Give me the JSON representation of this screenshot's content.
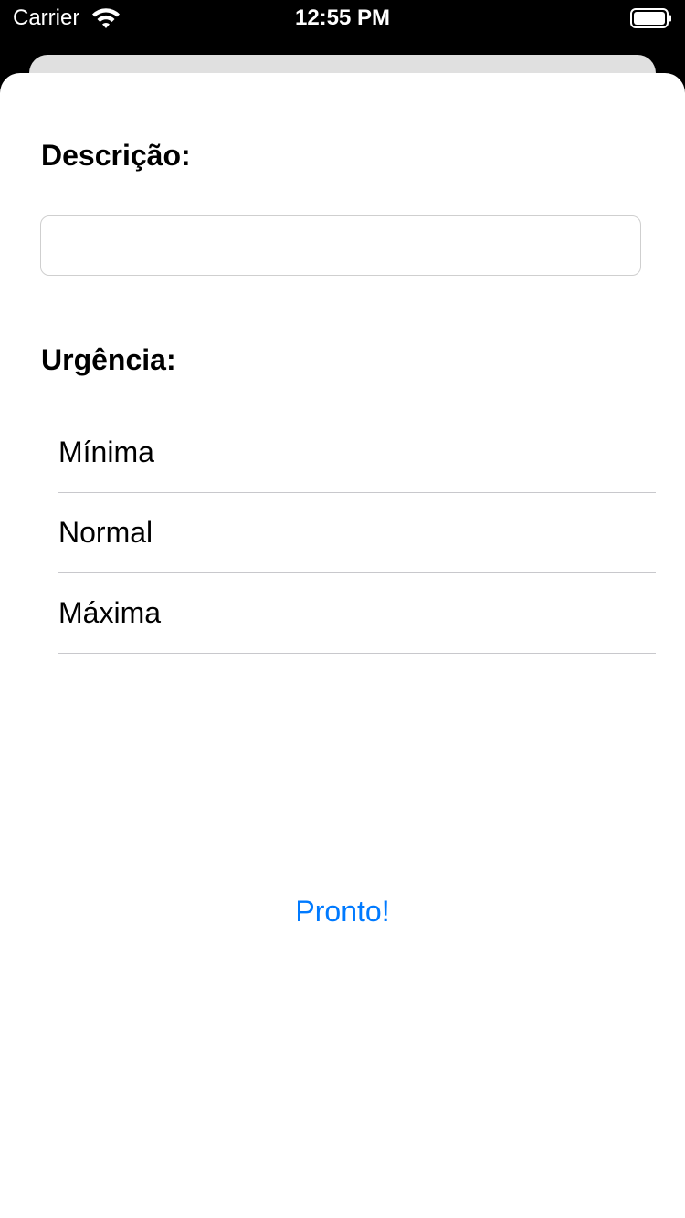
{
  "status_bar": {
    "carrier": "Carrier",
    "time": "12:55 PM"
  },
  "form": {
    "description_label": "Descrição:",
    "description_value": "",
    "urgency_label": "Urgência:",
    "urgency_options": [
      {
        "label": "Mínima"
      },
      {
        "label": "Normal"
      },
      {
        "label": "Máxima"
      }
    ],
    "done_label": "Pronto!"
  },
  "colors": {
    "accent": "#007aff",
    "separator": "#c8c8cc"
  },
  "icons": [
    "wifi-icon",
    "battery-icon"
  ]
}
